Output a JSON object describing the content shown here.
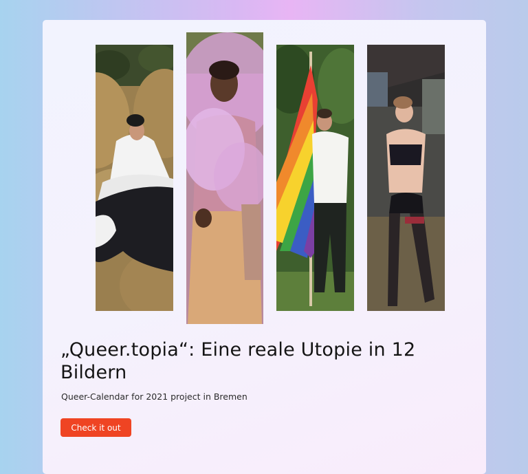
{
  "card": {
    "title": "„Queer.topia“: Eine reale Utopie in 12 Bildern",
    "subtitle": "Queer-Calendar for 2021 project in Bremen",
    "cta_label": "Check it out"
  },
  "colors": {
    "accent": "#ef4423",
    "card_background": "#f3f2fd"
  },
  "photos": [
    "calendar-photo-hay-bales",
    "calendar-photo-pink-smoke",
    "calendar-photo-rainbow-flag",
    "calendar-photo-harness"
  ]
}
